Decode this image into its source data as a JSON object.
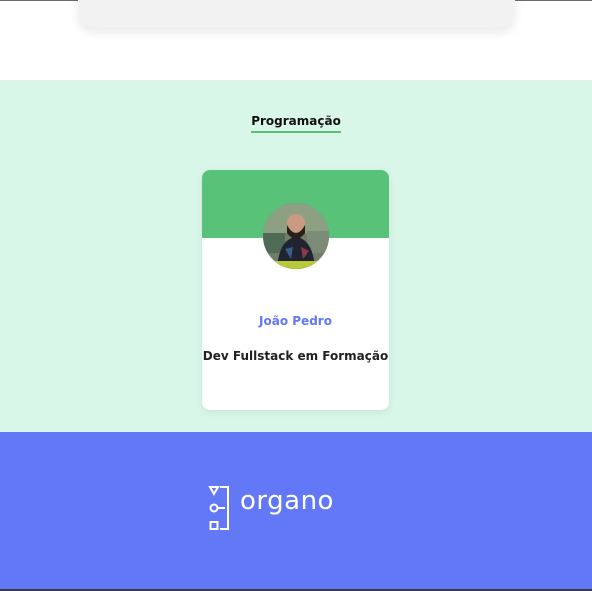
{
  "colors": {
    "page_background": "#ffffff",
    "section_background": "#d9f7e9",
    "section_accent": "#57c278",
    "member_name_color": "#6278f7",
    "footer_background": "#6278f7"
  },
  "team": {
    "title": "Programação",
    "members": [
      {
        "name": "João Pedro",
        "role": "Dev Fullstack em Formação",
        "avatar_icon": "person-photo"
      }
    ]
  },
  "footer": {
    "logo_text": "organo",
    "logo_icon": "organo-logo-icon"
  }
}
